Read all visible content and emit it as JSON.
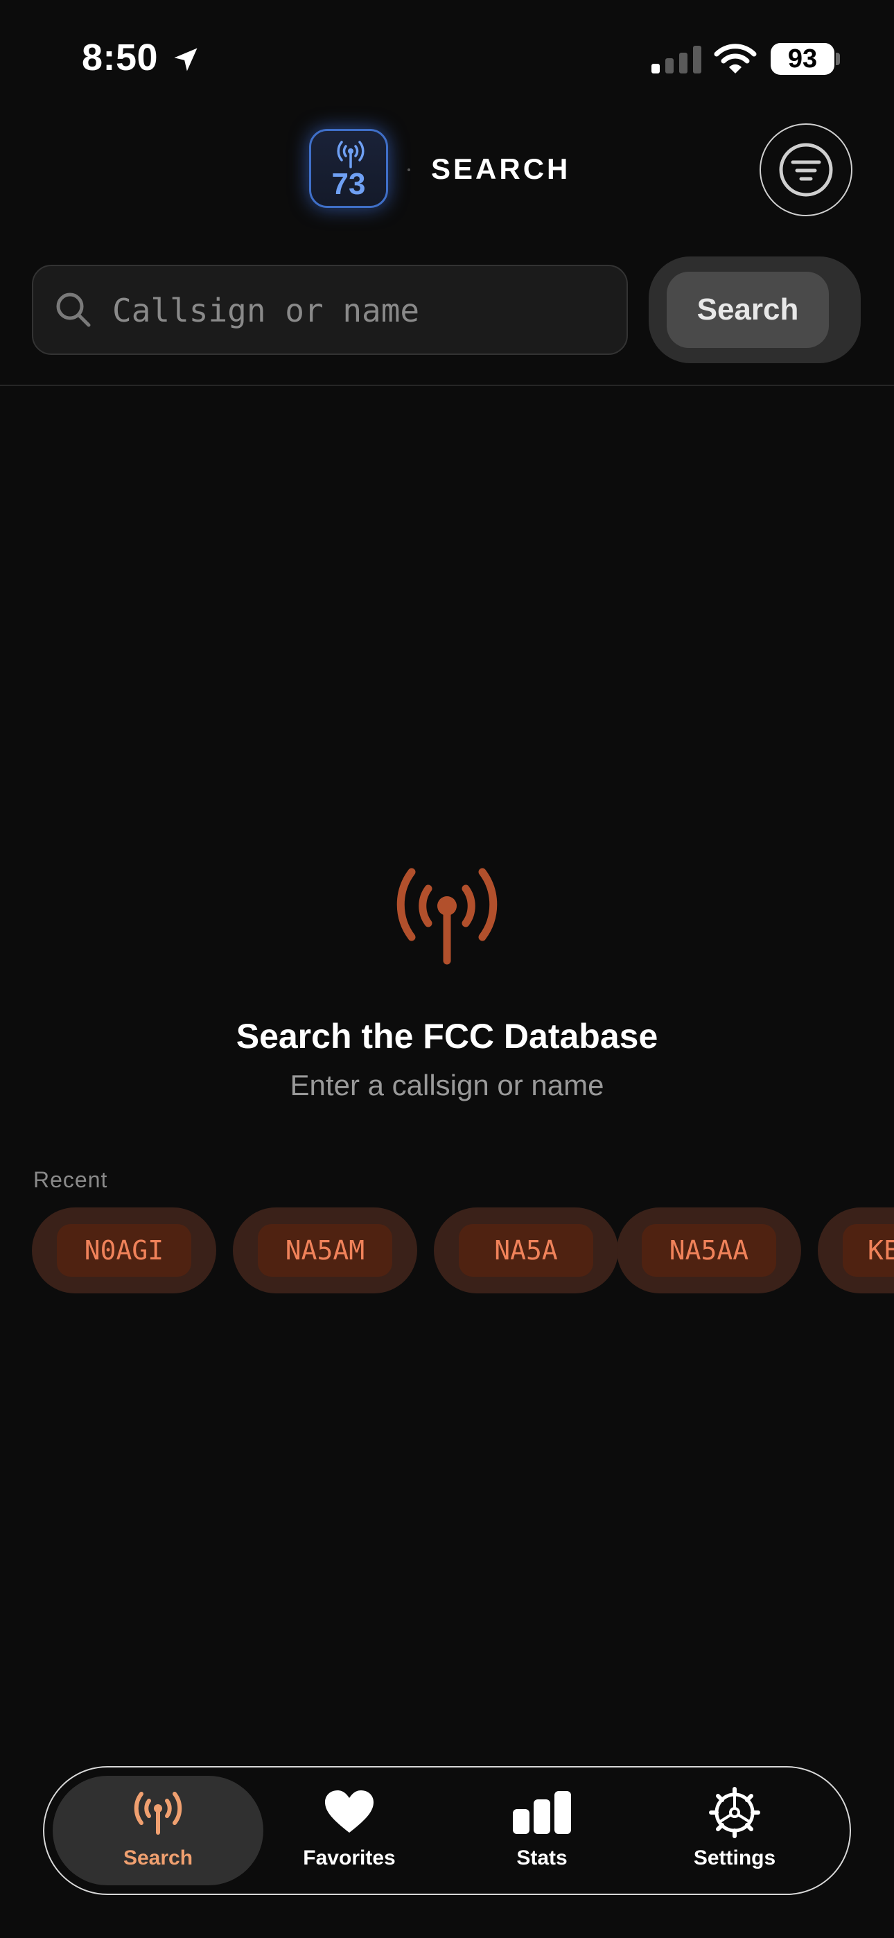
{
  "status_bar": {
    "time": "8:50",
    "battery": "93"
  },
  "header": {
    "badge_number": "73",
    "title": "SEARCH"
  },
  "search": {
    "placeholder": "Callsign or name",
    "button_label": "Search"
  },
  "empty_state": {
    "title": "Search the FCC Database",
    "subtitle": "Enter a callsign or name"
  },
  "recent": {
    "label": "Recent",
    "items": [
      "N0AGI",
      "NA5AM",
      "NA5A",
      "NA5AA",
      "KE"
    ]
  },
  "tabs": [
    {
      "label": "Search",
      "icon": "antenna-icon",
      "active": true
    },
    {
      "label": "Favorites",
      "icon": "heart-icon",
      "active": false
    },
    {
      "label": "Stats",
      "icon": "bar-chart-icon",
      "active": false
    },
    {
      "label": "Settings",
      "icon": "gear-icon",
      "active": false
    }
  ],
  "colors": {
    "background": "#0c0c0c",
    "accent": "#f0825a",
    "antenna": "#b2502c",
    "badge_blue": "#6fa0f4"
  }
}
